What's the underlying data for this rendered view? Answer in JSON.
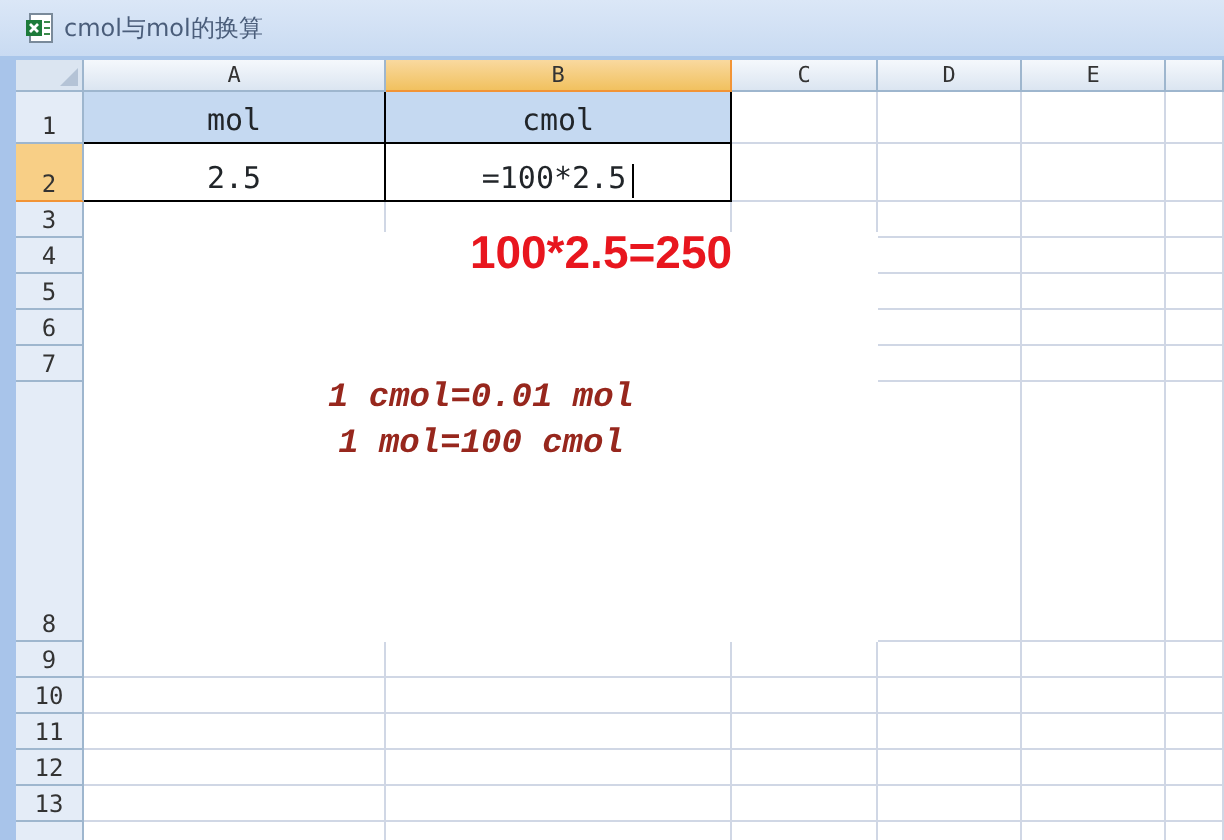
{
  "window": {
    "title": "cmol与mol的换算"
  },
  "columns": [
    {
      "label": "A",
      "selected": false
    },
    {
      "label": "B",
      "selected": true
    },
    {
      "label": "C",
      "selected": false
    },
    {
      "label": "D",
      "selected": false
    },
    {
      "label": "E",
      "selected": false
    },
    {
      "selected": false
    }
  ],
  "rows": [
    {
      "label": "1",
      "selected": false,
      "kind": "header",
      "cells": [
        {
          "text": "mol",
          "editing": false
        },
        {
          "text": "cmol",
          "editing": false
        }
      ]
    },
    {
      "label": "2",
      "selected": true,
      "kind": "data",
      "cells": [
        {
          "text": "2.5",
          "editing": false
        },
        {
          "text": "=100*2.5",
          "editing": true
        }
      ]
    },
    {
      "label": "3",
      "selected": false,
      "cells": []
    },
    {
      "label": "4",
      "selected": false
    },
    {
      "label": "5",
      "selected": false
    },
    {
      "label": "6",
      "selected": false
    },
    {
      "label": "7",
      "selected": false
    },
    {
      "label": "8",
      "selected": false,
      "kind": "tall"
    },
    {
      "label": "9",
      "selected": false
    },
    {
      "label": "10",
      "selected": false
    },
    {
      "label": "11",
      "selected": false
    },
    {
      "label": "12",
      "selected": false
    },
    {
      "label": "13",
      "selected": false
    },
    {
      "selected": false
    }
  ],
  "text_box": {
    "result": "100*2.5=250",
    "lines": [
      "1 cmol=0.01 mol",
      "1 mol=100 cmol"
    ]
  }
}
